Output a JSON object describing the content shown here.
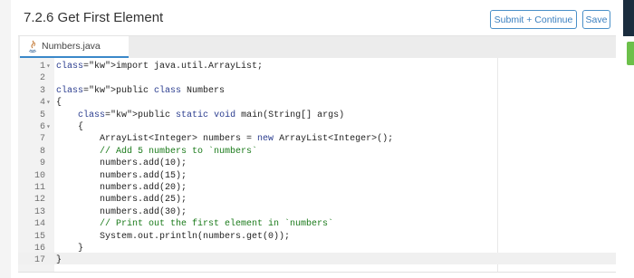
{
  "header": {
    "title": "7.2.6 Get First Element",
    "submit_label": "Submit + Continue",
    "save_label": "Save"
  },
  "tab": {
    "filename": "Numbers.java"
  },
  "editor": {
    "lines": [
      {
        "n": "1",
        "fold": "▾",
        "text": "import java.util.ArrayList;"
      },
      {
        "n": "2",
        "fold": "",
        "text": ""
      },
      {
        "n": "3",
        "fold": "",
        "text": "public class Numbers"
      },
      {
        "n": "4",
        "fold": "▾",
        "text": "{"
      },
      {
        "n": "5",
        "fold": "",
        "text": "    public static void main(String[] args)"
      },
      {
        "n": "6",
        "fold": "▾",
        "text": "    {"
      },
      {
        "n": "7",
        "fold": "",
        "text": "        ArrayList<Integer> numbers = new ArrayList<Integer>();"
      },
      {
        "n": "8",
        "fold": "",
        "text": "        // Add 5 numbers to `numbers`"
      },
      {
        "n": "9",
        "fold": "",
        "text": "        numbers.add(10);"
      },
      {
        "n": "10",
        "fold": "",
        "text": "        numbers.add(15);"
      },
      {
        "n": "11",
        "fold": "",
        "text": "        numbers.add(20);"
      },
      {
        "n": "12",
        "fold": "",
        "text": "        numbers.add(25);"
      },
      {
        "n": "13",
        "fold": "",
        "text": "        numbers.add(30);"
      },
      {
        "n": "14",
        "fold": "",
        "text": "        // Print out the first element in `numbers`"
      },
      {
        "n": "15",
        "fold": "",
        "text": "        System.out.println(numbers.get(0));"
      },
      {
        "n": "16",
        "fold": "",
        "text": "    }"
      },
      {
        "n": "17",
        "fold": "",
        "text": "}"
      }
    ]
  },
  "colors": {
    "accent": "#3a88c9",
    "brand_dark": "#1b2d3e",
    "green_tab": "#6cc04a"
  }
}
